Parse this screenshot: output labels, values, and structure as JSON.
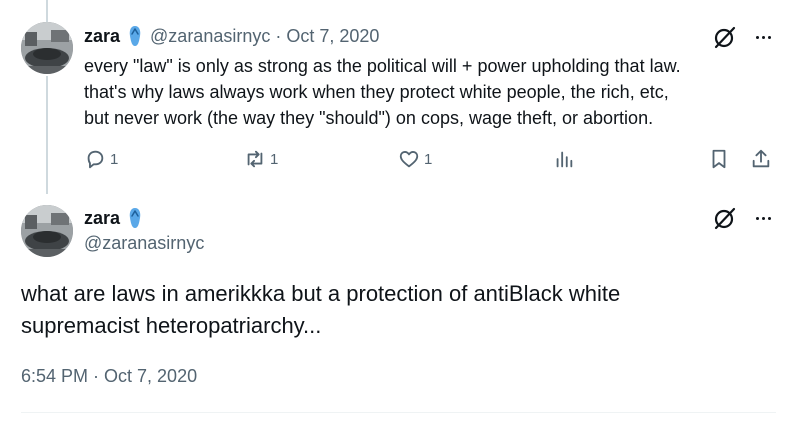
{
  "reply_tweet": {
    "author_name": "zara",
    "author_handle": "@zaranasirnyc",
    "separator": "·",
    "date": "Oct 7, 2020",
    "text_lines": [
      "every \"law\" is only as strong as the political will + power upholding that law.",
      "that's why laws always work when they protect white people, the rich, etc,",
      "but never work (the way they \"should\") on cops, wage theft, or abortion."
    ],
    "actions": {
      "reply_count": "1",
      "retweet_count": "1",
      "like_count": "1"
    }
  },
  "main_tweet": {
    "author_name": "zara",
    "author_handle": "@zaranasirnyc",
    "text_lines": [
      "what are laws in amerikkka but a protection of antiBlack white",
      "supremacist heteropatriarchy..."
    ],
    "timestamp": "6:54 PM · Oct 7, 2020"
  },
  "colors": {
    "text_primary": "#0f1419",
    "text_secondary": "#536471",
    "thread_line": "#cfd9de",
    "flip_flop_emoji": "#5aa8e8"
  },
  "icons": [
    "flip-flop-emoji-icon",
    "grok-icon",
    "more-icon",
    "reply-icon",
    "retweet-icon",
    "like-icon",
    "views-icon",
    "bookmark-icon",
    "share-icon"
  ]
}
